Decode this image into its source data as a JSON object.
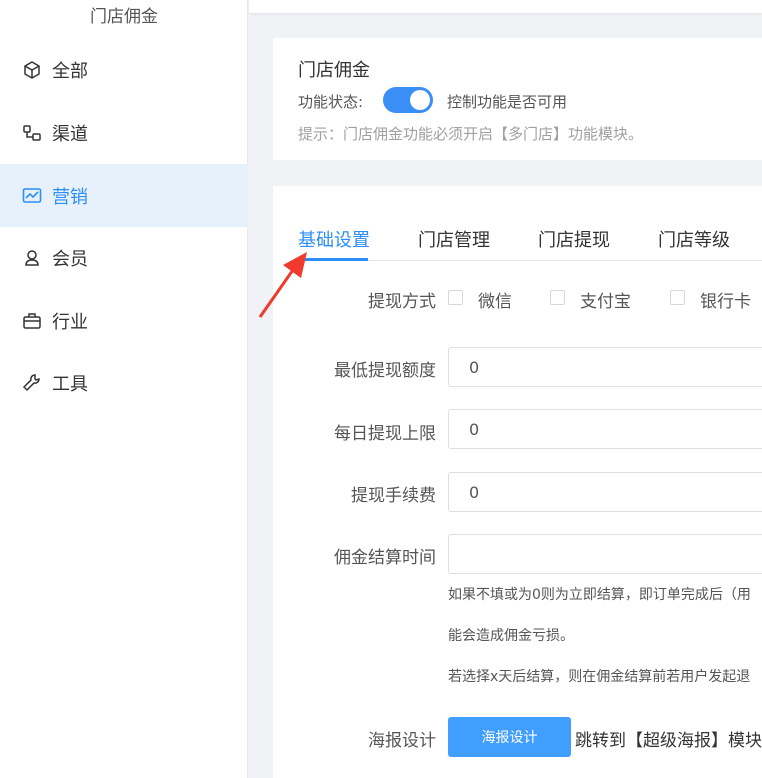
{
  "sidebar": {
    "title": "门店佣金",
    "items": [
      {
        "label": "全部",
        "icon": "box-icon"
      },
      {
        "label": "渠道",
        "icon": "channel-icon"
      },
      {
        "label": "营销",
        "icon": "chart-icon",
        "active": true
      },
      {
        "label": "会员",
        "icon": "user-icon"
      },
      {
        "label": "行业",
        "icon": "briefcase-icon"
      },
      {
        "label": "工具",
        "icon": "wrench-icon"
      }
    ]
  },
  "card1": {
    "title": "门店佣金",
    "status_label": "功能状态:",
    "toggle_on": true,
    "toggle_desc": "控制功能是否可用",
    "hint": "提示：门店佣金功能必须开启【多门店】功能模块。"
  },
  "tabs": [
    {
      "label": "基础设置",
      "active": true
    },
    {
      "label": "门店管理"
    },
    {
      "label": "门店提现"
    },
    {
      "label": "门店等级"
    }
  ],
  "form": {
    "withdraw_method": {
      "label": "提现方式",
      "options": [
        "微信",
        "支付宝",
        "银行卡"
      ]
    },
    "min_withdraw": {
      "label": "最低提现额度",
      "value": "0"
    },
    "daily_limit": {
      "label": "每日提现上限",
      "value": "0"
    },
    "fee": {
      "label": "提现手续费",
      "value": "0"
    },
    "settle_time": {
      "label": "佣金结算时间",
      "value": "",
      "help": [
        "如果不填或为0则为立即结算，即订单完成后（用",
        "能会造成佣金亏损。",
        "若选择x天后结算，则在佣金结算前若用户发起退"
      ]
    },
    "poster": {
      "label": "海报设计",
      "button": "海报设计",
      "after": "跳转到【超级海报】模块"
    }
  },
  "colors": {
    "accent": "#2c8ef8",
    "active_bg": "#e6f1fc",
    "button": "#409eff",
    "annotation_arrow": "#f03a2e"
  }
}
